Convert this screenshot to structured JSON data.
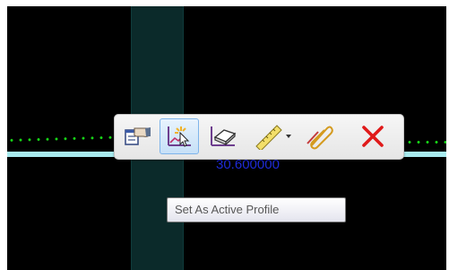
{
  "viewport": {
    "background": "#000000",
    "measure_value": "30.600000"
  },
  "colors": {
    "accent_line": "#a9ebef",
    "dotted_line": "#17d817",
    "band": "#0b2a2a",
    "measure_text": "#1e2bd8",
    "delete_icon": "#e01a1a"
  },
  "toolbar": {
    "buttons": [
      {
        "icon": "properties-hand-icon",
        "active": false
      },
      {
        "icon": "set-active-profile-icon",
        "active": true
      },
      {
        "icon": "eraser-icon",
        "active": false
      },
      {
        "icon": "ruler-measure-icon",
        "has_dropdown": true,
        "active": false
      },
      {
        "icon": "paperclip-icon",
        "active": false
      },
      {
        "icon": "delete-x-icon",
        "active": false
      }
    ]
  },
  "tooltip": {
    "text": "Set As Active Profile"
  }
}
